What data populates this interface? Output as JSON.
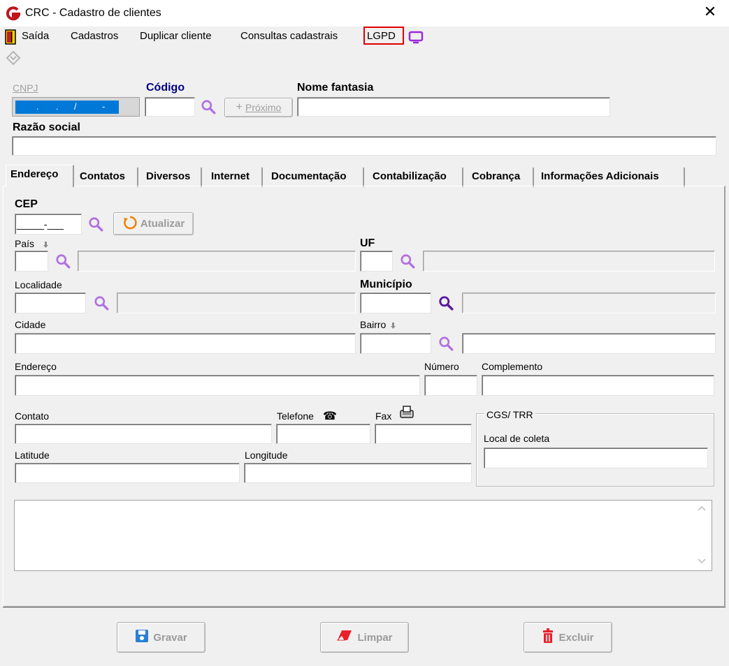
{
  "window": {
    "title": "CRC - Cadastro de clientes",
    "close": "✕"
  },
  "menu": {
    "saida": "Saída",
    "cadastros": "Cadastros",
    "duplicar": "Duplicar cliente",
    "consultas": "Consultas cadastrais",
    "lgpd": "LGPD"
  },
  "header": {
    "cnpj_label": "CNPJ",
    "cnpj_mask": "  .   .   /    -  ",
    "codigo_label": "Código",
    "proximo_label": "Próximo",
    "nome_fantasia_label": "Nome fantasia",
    "razao_social_label": "Razão social"
  },
  "tabs": [
    "Endereço",
    "Contatos",
    "Diversos",
    "Internet",
    "Documentação",
    "Contabilização",
    "Cobrança",
    "Informações Adicionais"
  ],
  "address": {
    "cep_label": "CEP",
    "cep_mask": "_____-___",
    "atualizar_label": "Atualizar",
    "pais_label": "País",
    "uf_label": "UF",
    "localidade_label": "Localidade",
    "municipio_label": "Município",
    "cidade_label": "Cidade",
    "bairro_label": "Bairro",
    "endereco_label": "Endereço",
    "numero_label": "Número",
    "complemento_label": "Complemento",
    "contato_label": "Contato",
    "telefone_label": "Telefone",
    "fax_label": "Fax",
    "latitude_label": "Latitude",
    "longitude_label": "Longitude",
    "cgs_group_label": "CGS/ TRR",
    "local_coleta_label": "Local de coleta"
  },
  "footer": {
    "gravar": "Gravar",
    "limpar": "Limpar",
    "excluir": "Excluir"
  },
  "colors": {
    "accent_purple": "#8a2be2",
    "lgpd_border": "#e00000",
    "label_navy": "#000080",
    "selection_blue": "#0078d7"
  },
  "icons": [
    "app-logo-icon",
    "close-icon",
    "exit-door-icon",
    "monitor-icon",
    "diamond-arrows-icon",
    "search-icon",
    "plus-icon",
    "refresh-icon",
    "down-arrow-icon",
    "phone-icon",
    "fax-icon",
    "save-icon",
    "eraser-icon",
    "trash-icon"
  ]
}
